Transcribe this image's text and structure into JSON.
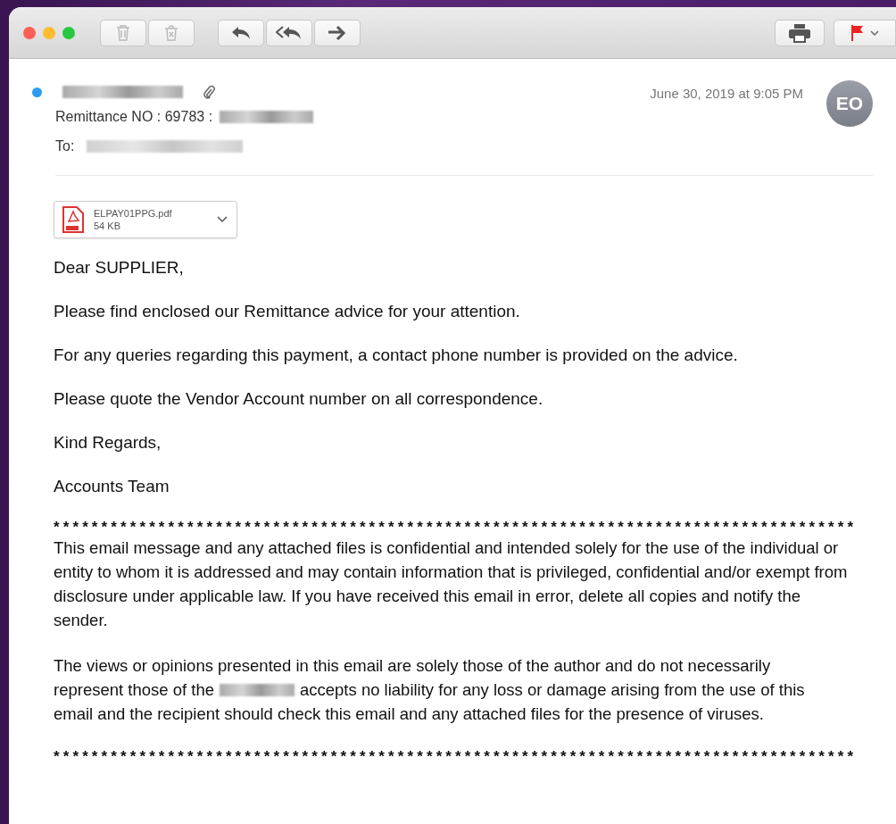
{
  "header": {
    "unread": true,
    "has_attachment": true,
    "subject_prefix": "Remittance NO : 69783 :",
    "to_label": "To:",
    "date": "June 30, 2019 at 9:05 PM",
    "avatar": "EO"
  },
  "attachment": {
    "name": "ELPAY01PPG.pdf",
    "size": "54 KB"
  },
  "body": [
    "Dear SUPPLIER,",
    "Please find enclosed our Remittance advice for your attention.",
    "For any queries regarding this payment, a contact phone number is provided on the advice.",
    "Please quote the Vendor Account number on all correspondence.",
    "Kind Regards,",
    "Accounts Team"
  ],
  "separator": "************************************************************************************",
  "disclaimer": "This email message and any attached files is confidential and intended solely for the use of the individual or entity to whom it is addressed and may contain information that is privileged, confidential and/or exempt from disclosure under applicable law. If you have received this email in error, delete all copies and notify the sender.",
  "disclaimer_2": {
    "line_1": "The views or opinions presented in this email are solely those of the author and do not necessarily",
    "before": "represent those of the",
    "after": "accepts no liability for any loss or damage arising from the use of this",
    "line_3": "email and the recipient should check this email and any attached files for the presence of viruses."
  }
}
